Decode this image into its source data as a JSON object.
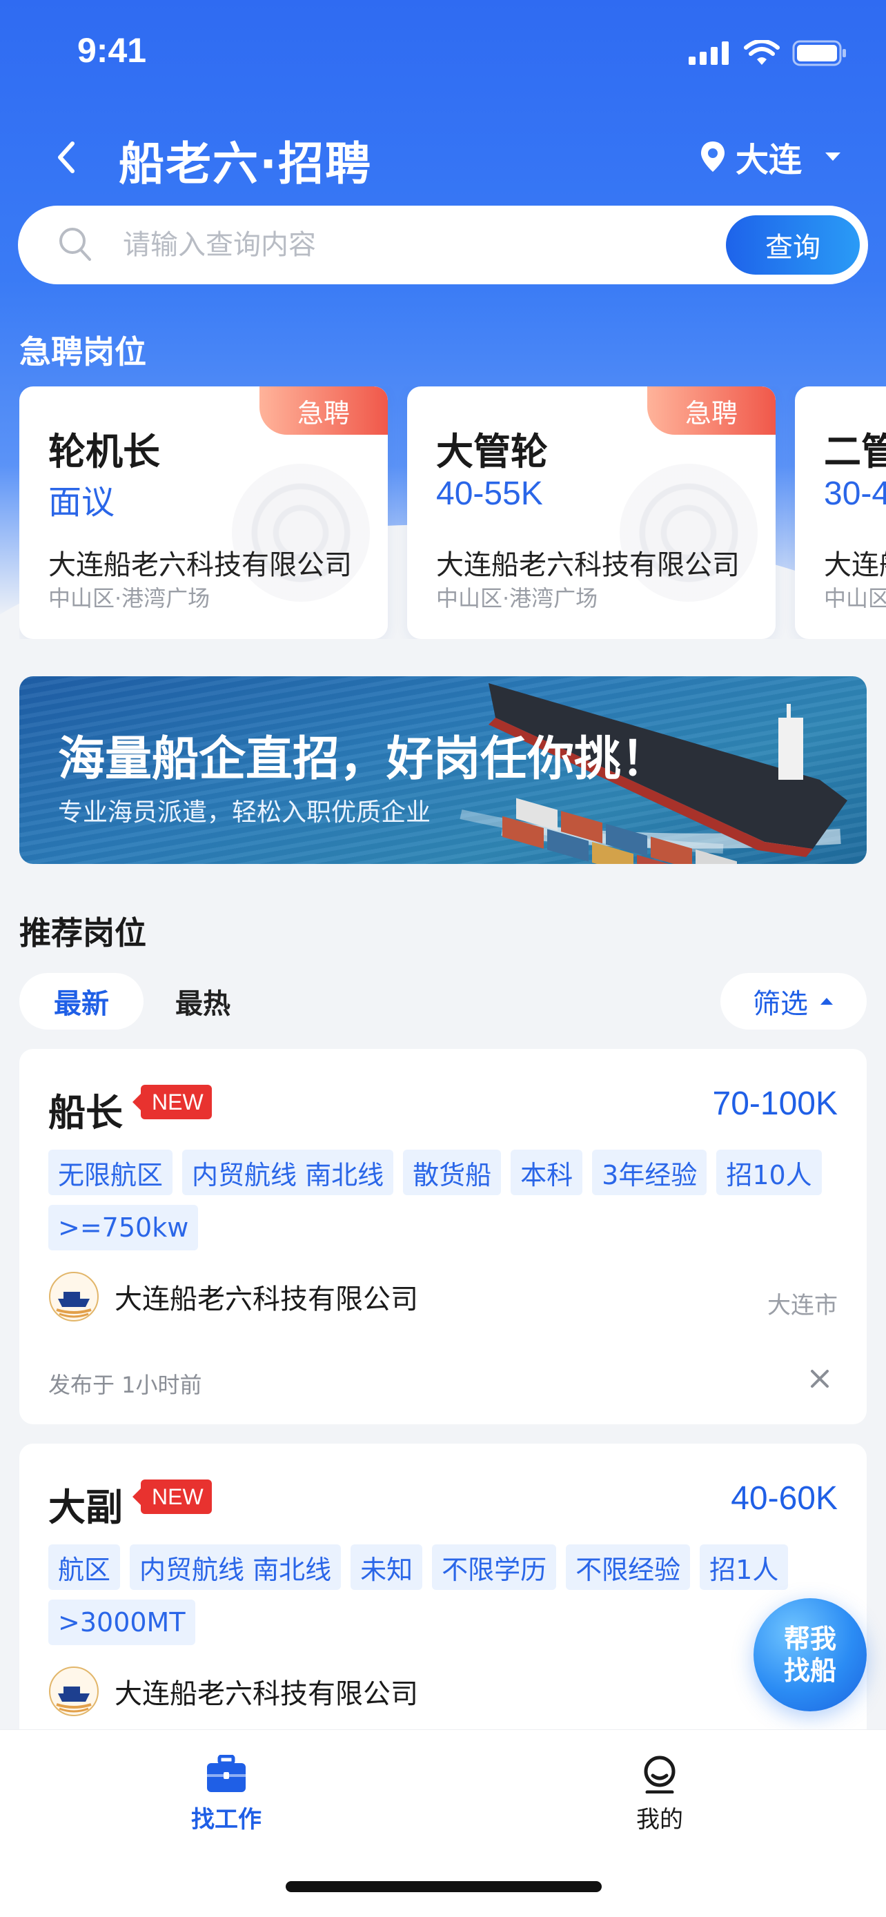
{
  "status_bar": {
    "time": "9:41"
  },
  "header": {
    "title": "船老六·招聘",
    "city": "大连"
  },
  "search": {
    "placeholder": "请输入查询内容",
    "button": "查询"
  },
  "urgent": {
    "title": "急聘岗位",
    "tag": "急聘",
    "cards": [
      {
        "job": "轮机长",
        "salary": "面议",
        "company": "大连船老六科技有限公司",
        "location": "中山区·港湾广场"
      },
      {
        "job": "大管轮",
        "salary": "40-55K",
        "company": "大连船老六科技有限公司",
        "location": "中山区·港湾广场"
      },
      {
        "job": "二管",
        "salary": "30-4",
        "company": "大连船",
        "location": "中山区"
      }
    ]
  },
  "banner": {
    "headline": "海量船企直招，好岗任你挑！",
    "subline": "专业海员派遣，轻松入职优质企业"
  },
  "recommend": {
    "title": "推荐岗位",
    "tabs": [
      "最新",
      "最热"
    ],
    "filter": "筛选",
    "new_tag": "NEW",
    "jobs": [
      {
        "title": "船长",
        "salary": "70-100K",
        "tags": [
          "无限航区",
          "内贸航线 南北线",
          "散货船",
          "本科",
          "3年经验",
          "招10人",
          ">=750kw"
        ],
        "company": "大连船老六科技有限公司",
        "city": "大连市",
        "posted": "发布于 1小时前"
      },
      {
        "title": "大副",
        "salary": "40-60K",
        "tags": [
          "航区",
          "内贸航线 南北线",
          "未知",
          "不限学历",
          "不限经验",
          "招1人",
          ">3000MT"
        ],
        "company": "大连船老六科技有限公司"
      }
    ]
  },
  "fab": {
    "line1": "帮我",
    "line2": "找船"
  },
  "tabbar": {
    "items": [
      "找工作",
      "我的"
    ]
  },
  "colors": {
    "primary": "#1f5fe6",
    "urgent_tag": "#f0584a",
    "new_tag": "#e8322f"
  }
}
